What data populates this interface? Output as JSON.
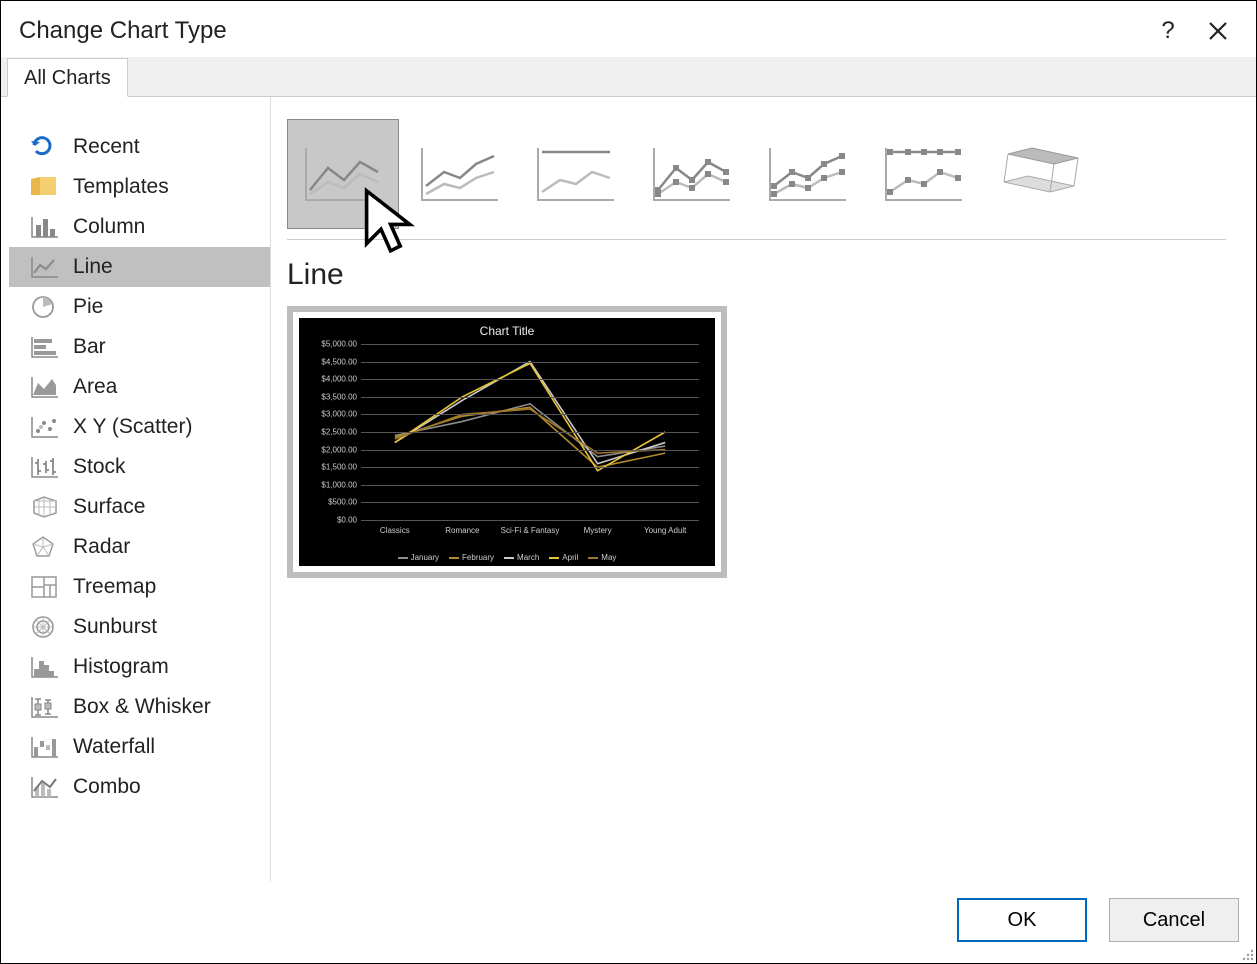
{
  "dialog": {
    "title": "Change Chart Type",
    "help_label": "?",
    "close_label": "✕"
  },
  "tabs": {
    "all_charts": "All Charts"
  },
  "categories": [
    {
      "id": "recent",
      "label": "Recent"
    },
    {
      "id": "templates",
      "label": "Templates"
    },
    {
      "id": "column",
      "label": "Column"
    },
    {
      "id": "line",
      "label": "Line",
      "selected": true
    },
    {
      "id": "pie",
      "label": "Pie"
    },
    {
      "id": "bar",
      "label": "Bar"
    },
    {
      "id": "area",
      "label": "Area"
    },
    {
      "id": "scatter",
      "label": "X Y (Scatter)"
    },
    {
      "id": "stock",
      "label": "Stock"
    },
    {
      "id": "surface",
      "label": "Surface"
    },
    {
      "id": "radar",
      "label": "Radar"
    },
    {
      "id": "treemap",
      "label": "Treemap"
    },
    {
      "id": "sunburst",
      "label": "Sunburst"
    },
    {
      "id": "histogram",
      "label": "Histogram"
    },
    {
      "id": "boxwhisker",
      "label": "Box & Whisker"
    },
    {
      "id": "waterfall",
      "label": "Waterfall"
    },
    {
      "id": "combo",
      "label": "Combo"
    }
  ],
  "subtypes": {
    "heading": "Line",
    "items": [
      {
        "id": "line",
        "name": "Line",
        "selected": true
      },
      {
        "id": "stacked-line",
        "name": "Stacked Line"
      },
      {
        "id": "100-stacked-line",
        "name": "100% Stacked Line"
      },
      {
        "id": "line-markers",
        "name": "Line with Markers"
      },
      {
        "id": "stacked-line-markers",
        "name": "Stacked Line with Markers"
      },
      {
        "id": "100-stacked-line-markers",
        "name": "100% Stacked Line with Markers"
      },
      {
        "id": "3d-line",
        "name": "3-D Line"
      }
    ]
  },
  "buttons": {
    "ok": "OK",
    "cancel": "Cancel"
  },
  "chart_data": {
    "type": "line",
    "title": "Chart Title",
    "categories": [
      "Classics",
      "Romance",
      "Sci-Fi & Fantasy",
      "Mystery",
      "Young Adult"
    ],
    "series": [
      {
        "name": "January",
        "color": "#8c8c8c",
        "values": [
          2400,
          2800,
          3300,
          1800,
          2100
        ]
      },
      {
        "name": "February",
        "color": "#b08a2b",
        "values": [
          2350,
          2950,
          3200,
          1500,
          1900
        ]
      },
      {
        "name": "March",
        "color": "#c9c9c9",
        "values": [
          2200,
          3400,
          4500,
          1600,
          2200
        ]
      },
      {
        "name": "April",
        "color": "#e6c238",
        "values": [
          2200,
          3500,
          4450,
          1400,
          2500
        ]
      },
      {
        "name": "May",
        "color": "#a0762a",
        "values": [
          2300,
          3000,
          3150,
          1900,
          2000
        ]
      }
    ],
    "y_ticks": [
      0,
      500,
      1000,
      1500,
      2000,
      2500,
      3000,
      3500,
      4000,
      4500,
      5000
    ],
    "y_tick_labels": [
      "$0.00",
      "$500.00",
      "$1,000.00",
      "$1,500.00",
      "$2,000.00",
      "$2,500.00",
      "$3,000.00",
      "$3,500.00",
      "$4,000.00",
      "$4,500.00",
      "$5,000.00"
    ],
    "ylim": [
      0,
      5000
    ]
  }
}
